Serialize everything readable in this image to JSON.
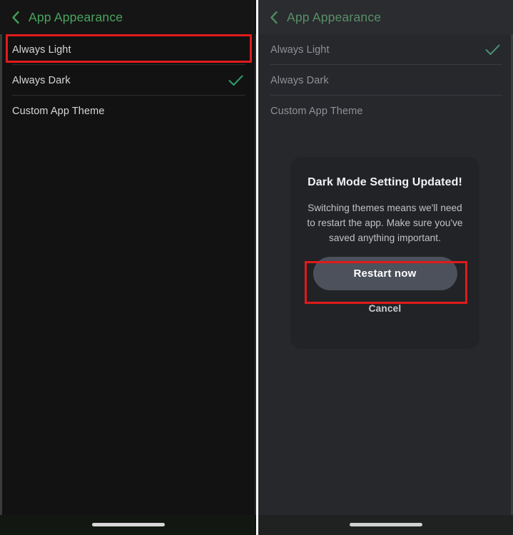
{
  "meta": {
    "screen_title": "App Appearance",
    "accent_green": "#4aa45f",
    "check_green": "#2f9e6b",
    "annotation_red": "#e01b1b",
    "button_gray": "#4c515b",
    "dialog_bg": "#222327",
    "panel_left_bg": "#121212",
    "panel_right_bg": "#26282c"
  },
  "left_panel": {
    "header": {
      "back_icon": "chevron-left-icon",
      "title": "App Appearance"
    },
    "options": [
      {
        "label": "Always Light",
        "checked": false,
        "highlighted": true
      },
      {
        "label": "Always Dark",
        "checked": true,
        "highlighted": false
      },
      {
        "label": "Custom App Theme",
        "checked": false,
        "highlighted": false
      }
    ],
    "check_icon": "checkmark-icon",
    "home_indicator": "home-indicator"
  },
  "right_panel": {
    "header": {
      "back_icon": "chevron-left-icon",
      "title": "App Appearance"
    },
    "options": [
      {
        "label": "Always Light",
        "checked": true,
        "highlighted": false
      },
      {
        "label": "Always Dark",
        "checked": false,
        "highlighted": false
      },
      {
        "label": "Custom App Theme",
        "checked": false,
        "highlighted": false
      }
    ],
    "check_icon": "checkmark-icon",
    "home_indicator": "home-indicator",
    "dialog": {
      "title": "Dark Mode Setting Updated!",
      "body": "Switching themes means we'll need to restart the app. Make sure you've saved anything important.",
      "primary_button": "Restart now",
      "secondary_button": "Cancel"
    }
  },
  "annotations": [
    {
      "name": "always-light-row-highlight",
      "target": "Always Light"
    },
    {
      "name": "restart-now-button-highlight",
      "target": "Restart now"
    }
  ]
}
